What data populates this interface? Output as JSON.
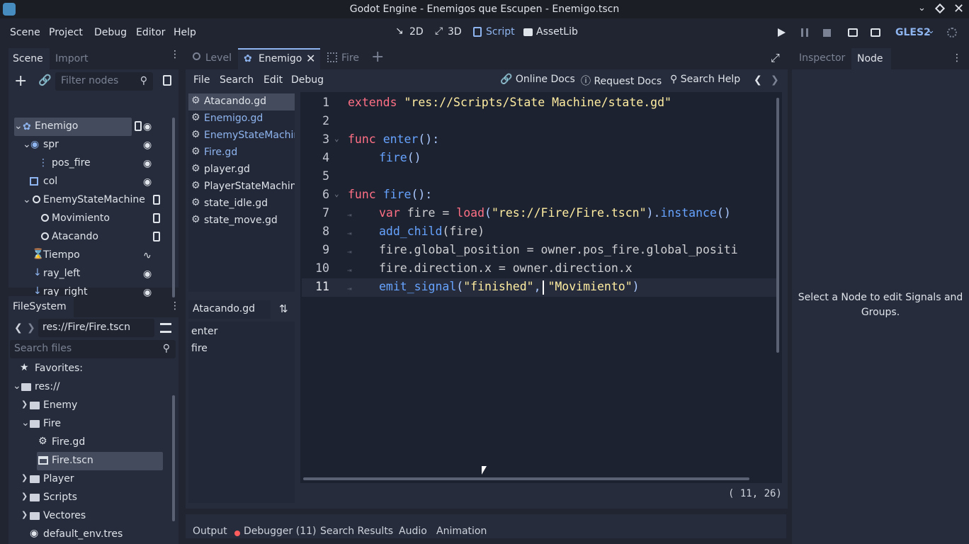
{
  "window": {
    "title": "Godot Engine - Enemigos que Escupen - Enemigo.tscn"
  },
  "menu": {
    "scene": "Scene",
    "project": "Project",
    "debug": "Debug",
    "editor": "Editor",
    "help": "Help"
  },
  "workspaces": {
    "w2d": "2D",
    "w3d": "3D",
    "script": "Script",
    "assetlib": "AssetLib"
  },
  "renderer": "GLES2",
  "scene_dock": {
    "tab_scene": "Scene",
    "tab_import": "Import",
    "filter_placeholder": "Filter nodes",
    "nodes": [
      {
        "label": "Enemigo"
      },
      {
        "label": "spr"
      },
      {
        "label": "pos_fire"
      },
      {
        "label": "col"
      },
      {
        "label": "EnemyStateMachine"
      },
      {
        "label": "Movimiento"
      },
      {
        "label": "Atacando"
      },
      {
        "label": "Tiempo"
      },
      {
        "label": "ray_left"
      },
      {
        "label": "ray_right"
      }
    ]
  },
  "filesystem": {
    "tab": "FileSystem",
    "path": "res://Fire/Fire.tscn",
    "search_placeholder": "Search files",
    "items": [
      {
        "label": "Favorites:"
      },
      {
        "label": "res://"
      },
      {
        "label": "Enemy"
      },
      {
        "label": "Fire"
      },
      {
        "label": "Fire.gd"
      },
      {
        "label": "Fire.tscn"
      },
      {
        "label": "Player"
      },
      {
        "label": "Scripts"
      },
      {
        "label": "Vectores"
      },
      {
        "label": "default_env.tres"
      }
    ]
  },
  "scene_tabs": {
    "level": "Level",
    "enemigo": "Enemigo",
    "fire": "Fire"
  },
  "script_menu": {
    "file": "File",
    "search": "Search",
    "edit": "Edit",
    "debug": "Debug",
    "online_docs": "Online Docs",
    "request_docs": "Request Docs",
    "search_help": "Search Help"
  },
  "script_list": [
    {
      "label": "Atacando.gd"
    },
    {
      "label": "Enemigo.gd"
    },
    {
      "label": "EnemyStateMachine.gd"
    },
    {
      "label": "Fire.gd"
    },
    {
      "label": "player.gd"
    },
    {
      "label": "PlayerStateMachine.gd"
    },
    {
      "label": "state_idle.gd"
    },
    {
      "label": "state_move.gd"
    }
  ],
  "methods": {
    "title": "Atacando.gd",
    "items": [
      {
        "label": "enter"
      },
      {
        "label": "fire"
      }
    ]
  },
  "code": {
    "line_numbers": [
      "1",
      "2",
      "3",
      "4",
      "5",
      "6",
      "7",
      "8",
      "9",
      "10",
      "11"
    ],
    "l1": {
      "kw": "extends",
      "str": "\"res://Scripts/State Machine/state.gd\""
    },
    "l3": {
      "kw": "func",
      "fn": "enter",
      "rest": "():"
    },
    "l4": {
      "fn": "fire",
      "rest": "()"
    },
    "l6": {
      "kw": "func",
      "fn": "fire",
      "rest": "():"
    },
    "l7": {
      "kw": "var",
      "id": " fire = ",
      "fn": "load",
      "p1": "(",
      "str": "\"res://Fire/Fire.tscn\"",
      "p2": ").",
      "fn2": "instance",
      "p3": "()"
    },
    "l8": {
      "fn": "add_child",
      "rest": "(fire)"
    },
    "l9": {
      "text": "fire.global_position = owner.pos_fire.global_positi"
    },
    "l10": {
      "text": "fire.direction.x = owner.direction.x"
    },
    "l11": {
      "fn": "emit_signal",
      "p1": "(",
      "str1": "\"finished\"",
      "p2": ", ",
      "str2": "\"Movimiento\"",
      "p3": ")"
    },
    "cursor": "( 11, 26)"
  },
  "right_dock": {
    "tab_inspector": "Inspector",
    "tab_node": "Node",
    "message": "Select a Node to edit Signals and Groups."
  },
  "bottom_panel": {
    "output": "Output",
    "debugger": "Debugger (11)",
    "search_results": "Search Results",
    "audio": "Audio",
    "animation": "Animation"
  }
}
